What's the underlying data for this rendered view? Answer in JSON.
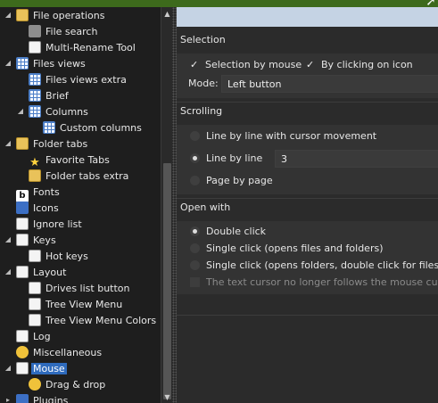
{
  "tree": {
    "items": [
      {
        "label": "File operations",
        "icon": "folder-icon"
      },
      {
        "label": "File search",
        "icon": "binoculars-icon"
      },
      {
        "label": "Multi-Rename Tool",
        "icon": "pencil-icon"
      },
      {
        "label": "Files views",
        "icon": "grid-icon"
      },
      {
        "label": "Files views extra",
        "icon": "grid-icon"
      },
      {
        "label": "Brief",
        "icon": "grid-icon"
      },
      {
        "label": "Columns",
        "icon": "grid-icon"
      },
      {
        "label": "Custom columns",
        "icon": "grid-icon"
      },
      {
        "label": "Folder tabs",
        "icon": "folder-icon"
      },
      {
        "label": "Favorite Tabs",
        "icon": "star-icon"
      },
      {
        "label": "Folder tabs extra",
        "icon": "folder-icon"
      },
      {
        "label": "Fonts",
        "icon": "font-icon"
      },
      {
        "label": "Icons",
        "icon": "footprint-icon"
      },
      {
        "label": "Ignore list",
        "icon": "ignore-icon"
      },
      {
        "label": "Keys",
        "icon": "keyboard-icon"
      },
      {
        "label": "Hot keys",
        "icon": "keyboard-icon"
      },
      {
        "label": "Layout",
        "icon": "layout-icon"
      },
      {
        "label": "Drives list button",
        "icon": "window-icon"
      },
      {
        "label": "Tree View Menu",
        "icon": "window-icon"
      },
      {
        "label": "Tree View Menu Colors",
        "icon": "window-icon"
      },
      {
        "label": "Log",
        "icon": "log-icon"
      },
      {
        "label": "Miscellaneous",
        "icon": "misc-icon"
      },
      {
        "label": "Mouse",
        "icon": "mouse-icon"
      },
      {
        "label": "Drag & drop",
        "icon": "drag-icon"
      },
      {
        "label": "Plugins",
        "icon": "plugin-icon"
      }
    ],
    "selected": "Mouse"
  },
  "selection": {
    "title": "Selection",
    "selection_by_mouse": "Selection by mouse",
    "by_clicking_on_icon": "By clicking on icon",
    "mode_label": "Mode:",
    "mode_value": "Left button"
  },
  "scrolling": {
    "title": "Scrolling",
    "option1": "Line by line with cursor movement",
    "option2": "Line by line",
    "option2_value": "3",
    "option3": "Page by page"
  },
  "open_with": {
    "title": "Open with",
    "option1": "Double click",
    "option2": "Single click (opens files and folders)",
    "option3": "Single click (opens folders, double click for files)",
    "option4": "The text cursor no longer follows the mouse cursor"
  },
  "colors": {
    "accent": "#2f6bbd",
    "header_bar": "#c5d3e4",
    "title_bar": "#3d6a1c"
  }
}
